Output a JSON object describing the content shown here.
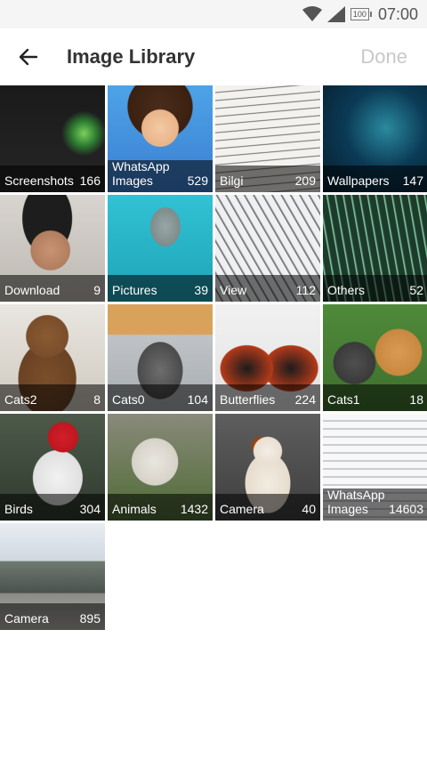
{
  "status": {
    "battery": "100",
    "time": "07:00"
  },
  "appbar": {
    "title": "Image Library",
    "done": "Done"
  },
  "albums": [
    {
      "name": "Screenshots",
      "count": "166"
    },
    {
      "name": "WhatsApp Images",
      "count": "529"
    },
    {
      "name": "Bilgi",
      "count": "209"
    },
    {
      "name": "Wallpapers",
      "count": "147"
    },
    {
      "name": "Download",
      "count": "9"
    },
    {
      "name": "Pictures",
      "count": "39"
    },
    {
      "name": "View",
      "count": "112"
    },
    {
      "name": "Others",
      "count": "52"
    },
    {
      "name": "Cats2",
      "count": "8"
    },
    {
      "name": "Cats0",
      "count": "104"
    },
    {
      "name": "Butterflies",
      "count": "224"
    },
    {
      "name": "Cats1",
      "count": "18"
    },
    {
      "name": "Birds",
      "count": "304"
    },
    {
      "name": "Animals",
      "count": "1432"
    },
    {
      "name": "Camera",
      "count": "40"
    },
    {
      "name": "WhatsApp Images",
      "count": "14603"
    },
    {
      "name": "Camera",
      "count": "895"
    }
  ]
}
